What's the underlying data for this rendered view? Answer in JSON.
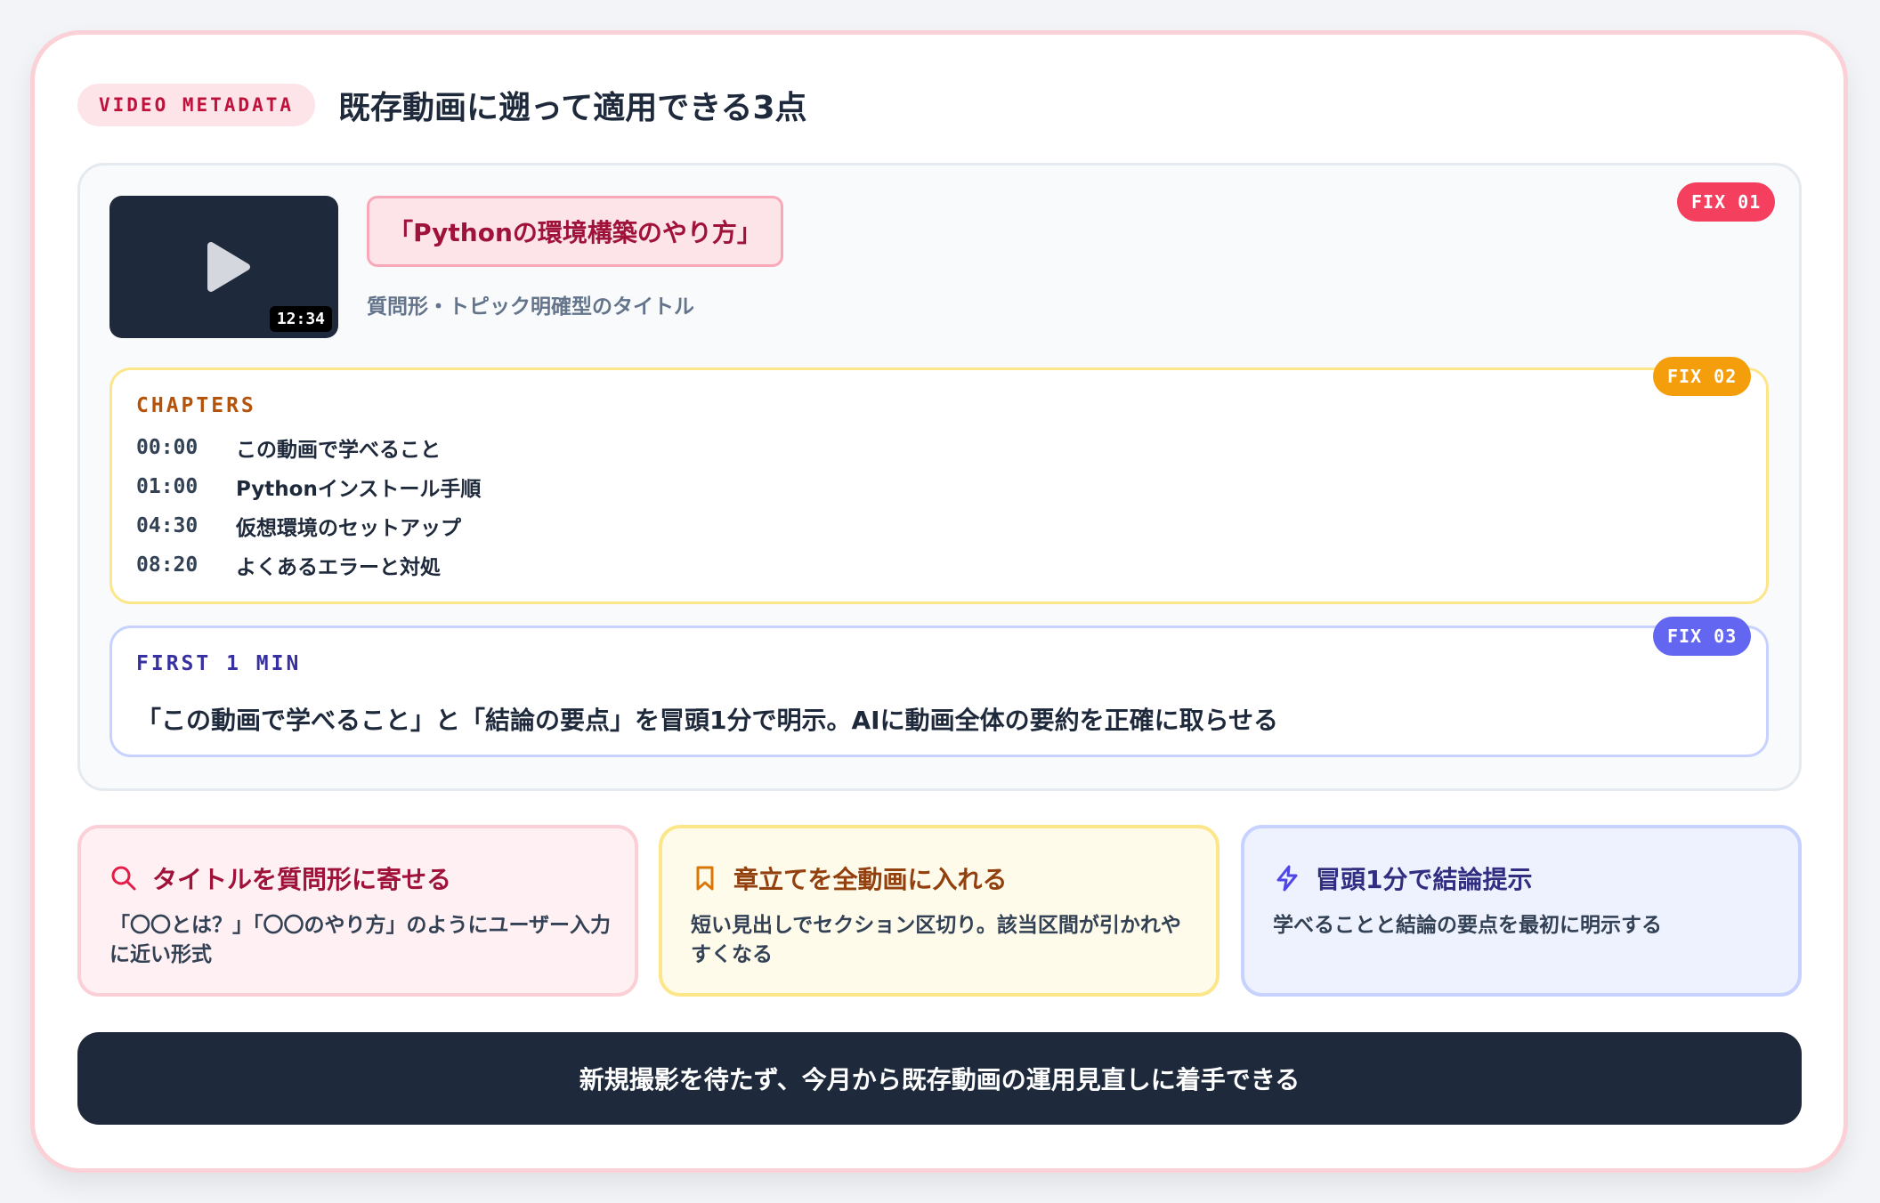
{
  "header": {
    "pill": "VIDEO METADATA",
    "title": "既存動画に遡って適用できる3点"
  },
  "video": {
    "duration": "12:34",
    "title": "「Pythonの環境構築のやり方」",
    "subtitle": "質問形・トピック明確型のタイトル"
  },
  "badges": {
    "fix1": "FIX 01",
    "fix2": "FIX 02",
    "fix3": "FIX 03"
  },
  "chapters": {
    "label": "CHAPTERS",
    "items": [
      {
        "time": "00:00",
        "text": "この動画で学べること"
      },
      {
        "time": "01:00",
        "text": "Pythonインストール手順"
      },
      {
        "time": "04:30",
        "text": "仮想環境のセットアップ"
      },
      {
        "time": "08:20",
        "text": "よくあるエラーと対処"
      }
    ]
  },
  "first_min": {
    "label": "FIRST 1 MIN",
    "text": "「この動画で学べること」と「結論の要点」を冒頭1分で明示。AIに動画全体の要約を正確に取らせる"
  },
  "cards": [
    {
      "icon": "search-icon",
      "title": "タイトルを質問形に寄せる",
      "body": "「〇〇とは？」「〇〇のやり方」のようにユーザー入力に近い形式"
    },
    {
      "icon": "bookmark-icon",
      "title": "章立てを全動画に入れる",
      "body": "短い見出しでセクション区切り。該当区間が引かれやすくなる"
    },
    {
      "icon": "lightning-icon",
      "title": "冒頭1分で結論提示",
      "body": "学べることと結論の要点を最初に明示する"
    }
  ],
  "footer": {
    "text": "新規撮影を待たず、今月から既存動画の運用見直しに着手できる"
  },
  "colors": {
    "pink": "#e11d48",
    "amber": "#f59e0b",
    "indigo": "#6366f1",
    "navy": "#1e293b"
  }
}
